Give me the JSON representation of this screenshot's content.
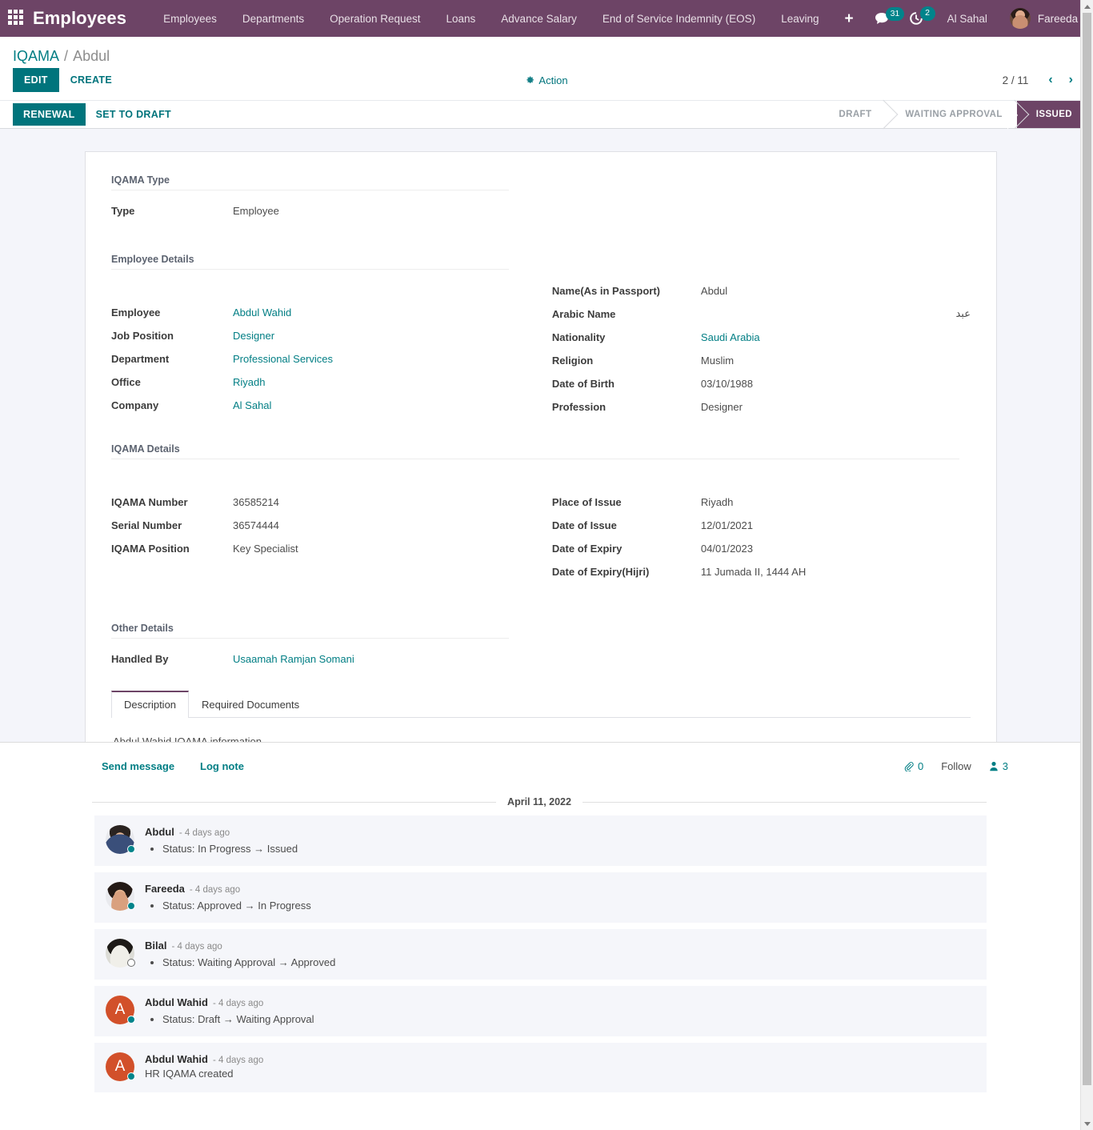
{
  "navbar": {
    "apps_icon": "apps-grid-icon",
    "brand": "Employees",
    "menu": [
      {
        "label": "Employees"
      },
      {
        "label": "Departments"
      },
      {
        "label": "Operation Request"
      },
      {
        "label": "Loans"
      },
      {
        "label": "Advance Salary"
      },
      {
        "label": "End of Service Indemnity (EOS)"
      },
      {
        "label": "Leaving"
      }
    ],
    "plus_label": "+",
    "messages_badge": "31",
    "activities_badge": "2",
    "company": "Al Sahal",
    "user": "Fareeda"
  },
  "breadcrumb": {
    "root": "IQAMA",
    "separator": "/",
    "current": "Abdul"
  },
  "control_panel": {
    "edit_label": "EDIT",
    "create_label": "CREATE",
    "action_label": "Action",
    "pager": "2 / 11",
    "prev_label": "‹",
    "next_label": "›"
  },
  "statusbar": {
    "buttons": [
      {
        "label": "RENEWAL",
        "primary": true
      },
      {
        "label": "SET TO DRAFT",
        "primary": false
      }
    ],
    "states": [
      {
        "label": "DRAFT",
        "active": false
      },
      {
        "label": "WAITING APPROVAL",
        "active": false
      },
      {
        "label": "ISSUED",
        "active": true
      }
    ]
  },
  "form": {
    "iqama_type": {
      "title": "IQAMA Type",
      "fields": [
        {
          "label": "Type",
          "value": "Employee",
          "link": false
        }
      ]
    },
    "employee_details": {
      "title": "Employee Details",
      "left": [
        {
          "label": "Employee",
          "value": "Abdul Wahid",
          "link": true
        },
        {
          "label": "Job Position",
          "value": "Designer",
          "link": true
        },
        {
          "label": "Department",
          "value": "Professional Services",
          "link": true
        },
        {
          "label": "Office",
          "value": "Riyadh",
          "link": true
        },
        {
          "label": "Company",
          "value": "Al Sahal",
          "link": true
        }
      ],
      "right": [
        {
          "label": "Name(As in Passport)",
          "value": "Abdul",
          "link": false
        },
        {
          "label": "Arabic Name",
          "value": "عبد",
          "link": false,
          "rtl": true
        },
        {
          "label": "Nationality",
          "value": "Saudi Arabia",
          "link": true
        },
        {
          "label": "Religion",
          "value": "Muslim",
          "link": false
        },
        {
          "label": "Date of Birth",
          "value": "03/10/1988",
          "link": false
        },
        {
          "label": "Profession",
          "value": "Designer",
          "link": false
        }
      ]
    },
    "iqama_details": {
      "title": "IQAMA Details",
      "left": [
        {
          "label": "IQAMA Number",
          "value": "36585214",
          "link": false
        },
        {
          "label": "Serial Number",
          "value": "36574444",
          "link": false
        },
        {
          "label": "IQAMA Position",
          "value": "Key Specialist",
          "link": false
        }
      ],
      "right": [
        {
          "label": "Place of Issue",
          "value": "Riyadh",
          "link": false
        },
        {
          "label": "Date of Issue",
          "value": "12/01/2021",
          "link": false
        },
        {
          "label": "Date of Expiry",
          "value": "04/01/2023",
          "link": false
        },
        {
          "label": "Date of Expiry(Hijri)",
          "value": "11 Jumada II, 1444 AH",
          "link": false
        }
      ]
    },
    "other_details": {
      "title": "Other Details",
      "left": [
        {
          "label": "Handled By",
          "value": "Usaamah Ramjan Somani",
          "link": true
        }
      ]
    },
    "notebook": {
      "tabs": [
        {
          "label": "Description",
          "active": true
        },
        {
          "label": "Required Documents",
          "active": false
        }
      ],
      "description_text": "Abdul Wahid IQAMA information"
    }
  },
  "chatter": {
    "send_message_label": "Send message",
    "log_note_label": "Log note",
    "attachment_icon": "paperclip-icon",
    "attachment_count": "0",
    "follow_label": "Follow",
    "followers_icon": "user-icon",
    "followers_count": "3",
    "date_separator": "April 11, 2022",
    "messages": [
      {
        "author": "Abdul",
        "time": "- 4 days ago",
        "avatar_type": "photo-male-glasses",
        "avatar_letter": "",
        "status": "online",
        "bullet": true,
        "text": "Status: In Progress → Issued"
      },
      {
        "author": "Fareeda",
        "time": "- 4 days ago",
        "avatar_type": "photo-female",
        "avatar_letter": "",
        "status": "online",
        "bullet": true,
        "text": "Status: Approved → In Progress"
      },
      {
        "author": "Bilal",
        "time": "- 4 days ago",
        "avatar_type": "photo-male-thobe",
        "avatar_letter": "",
        "status": "away",
        "bullet": true,
        "text": "Status: Waiting Approval → Approved"
      },
      {
        "author": "Abdul Wahid",
        "time": "- 4 days ago",
        "avatar_type": "letter",
        "avatar_letter": "A",
        "status": "online",
        "bullet": true,
        "text": "Status: Draft → Waiting Approval"
      },
      {
        "author": "Abdul Wahid",
        "time": "- 4 days ago",
        "avatar_type": "letter",
        "avatar_letter": "A",
        "status": "online",
        "bullet": false,
        "text": "HR IQAMA created"
      }
    ]
  },
  "colors": {
    "navbar_purple": "#6d4466",
    "accent_teal": "#017e84",
    "status_active_purple": "#6d4466",
    "avatar_orange": "#d2502a",
    "page_bg": "#f4f5fa",
    "message_bg": "#f5f6fa"
  }
}
